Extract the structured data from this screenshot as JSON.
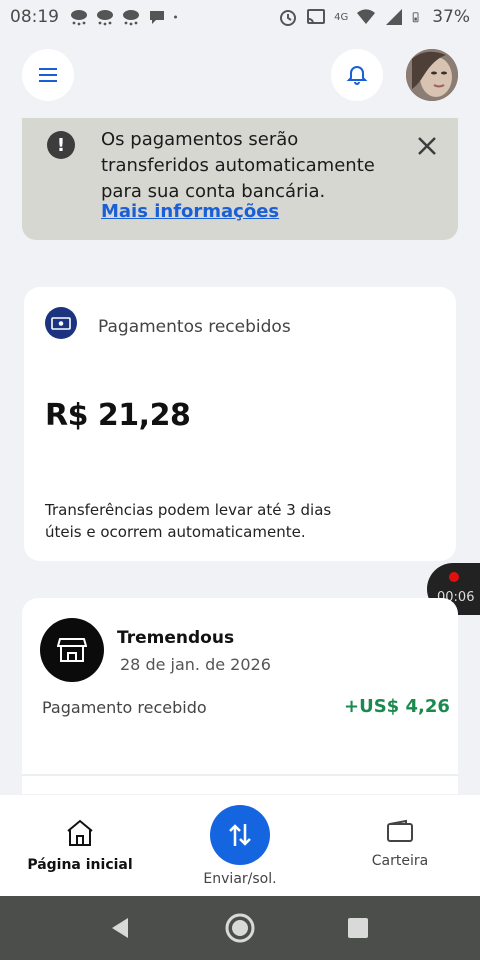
{
  "status_bar": {
    "time": "08:19",
    "network": "4G",
    "battery": "37%",
    "left_icons": [
      "weather-icon",
      "weather-icon",
      "weather-icon",
      "chat-icon",
      "dot-icon"
    ],
    "right_icons": [
      "alarm-icon",
      "cast-icon",
      "signal-icon",
      "wifi-icon",
      "signal-icon",
      "battery-icon"
    ]
  },
  "appbar": {
    "menu_icon": "menu-icon",
    "bell_icon": "bell-icon",
    "avatar": "avatar"
  },
  "banner": {
    "message": "Os pagamentos serão transferidos automaticamente para sua conta bancária.",
    "link": "Mais informações",
    "alert_icon": "!",
    "close_icon": "close-icon"
  },
  "payments_card": {
    "title": "Pagamentos recebidos",
    "amount": "R$ 21,28",
    "note": "Transferências podem levar até 3 dias úteis e ocorrem automaticamente."
  },
  "recording": {
    "time": "00:06"
  },
  "transaction": {
    "merchant": "Tremendous",
    "date": "28 de jan. de 2026",
    "status": "Pagamento recebido",
    "amount": "+US$ 4,26"
  },
  "bottom_nav": {
    "home": "Página inicial",
    "send": "Enviar/sol.",
    "wallet": "Carteira"
  },
  "colors": {
    "accent_blue": "#1565e0",
    "positive_green": "#1c8a4e",
    "banner_bg": "#d7d7d2",
    "page_bg": "#f1f2f5"
  }
}
